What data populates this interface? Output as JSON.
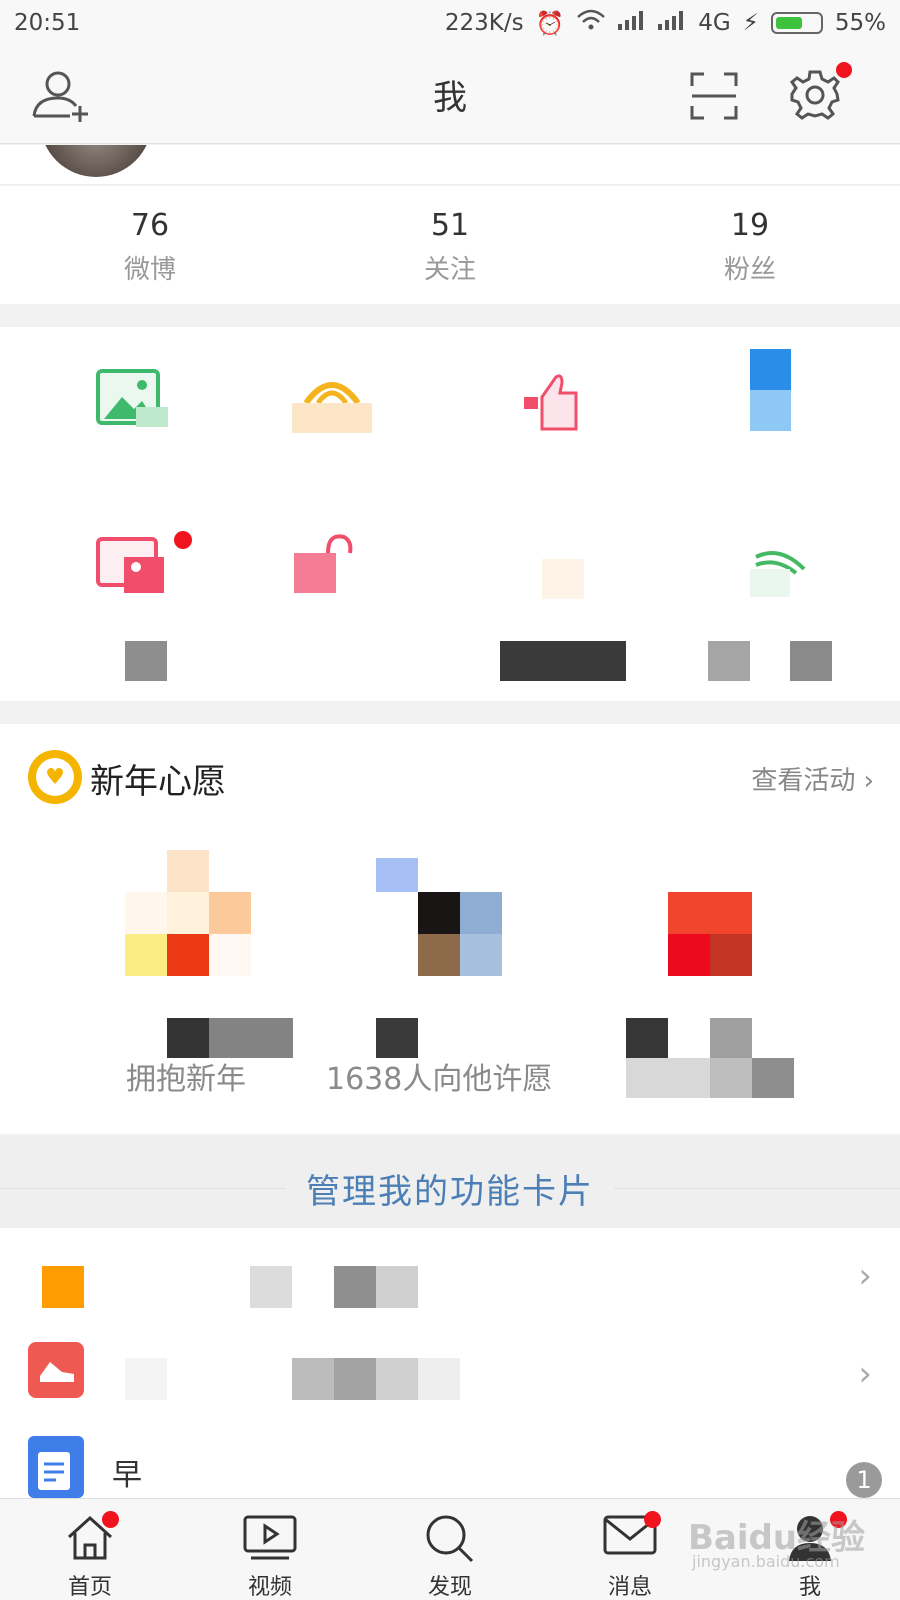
{
  "status_bar": {
    "time": "20:51",
    "speed": "223K/s",
    "network": "4G",
    "battery": "55%"
  },
  "nav": {
    "title": "我"
  },
  "stats": [
    {
      "value": "76",
      "label": "微博"
    },
    {
      "value": "51",
      "label": "关注"
    },
    {
      "value": "19",
      "label": "粉丝"
    }
  ],
  "wish": {
    "title": "新年心愿",
    "more": "查看活动",
    "caption_left": "拥抱新年",
    "caption_mid": "1638人向他许愿"
  },
  "manage": {
    "label": "管理我的功能卡片"
  },
  "list": {
    "third_label": "早"
  },
  "badge": "1",
  "tabs": [
    {
      "label": "首页",
      "icon": "home-icon"
    },
    {
      "label": "视频",
      "icon": "video-icon"
    },
    {
      "label": "发现",
      "icon": "search-icon"
    },
    {
      "label": "消息",
      "icon": "mail-icon"
    },
    {
      "label": "我",
      "icon": "profile-icon"
    }
  ],
  "watermark": "Baidu经验",
  "watermark_url": "jingyan.baidu.com",
  "colors": {
    "accent_red": "#f0141e",
    "link_blue": "#4c7fb5",
    "wish_gold": "#f5b400"
  }
}
